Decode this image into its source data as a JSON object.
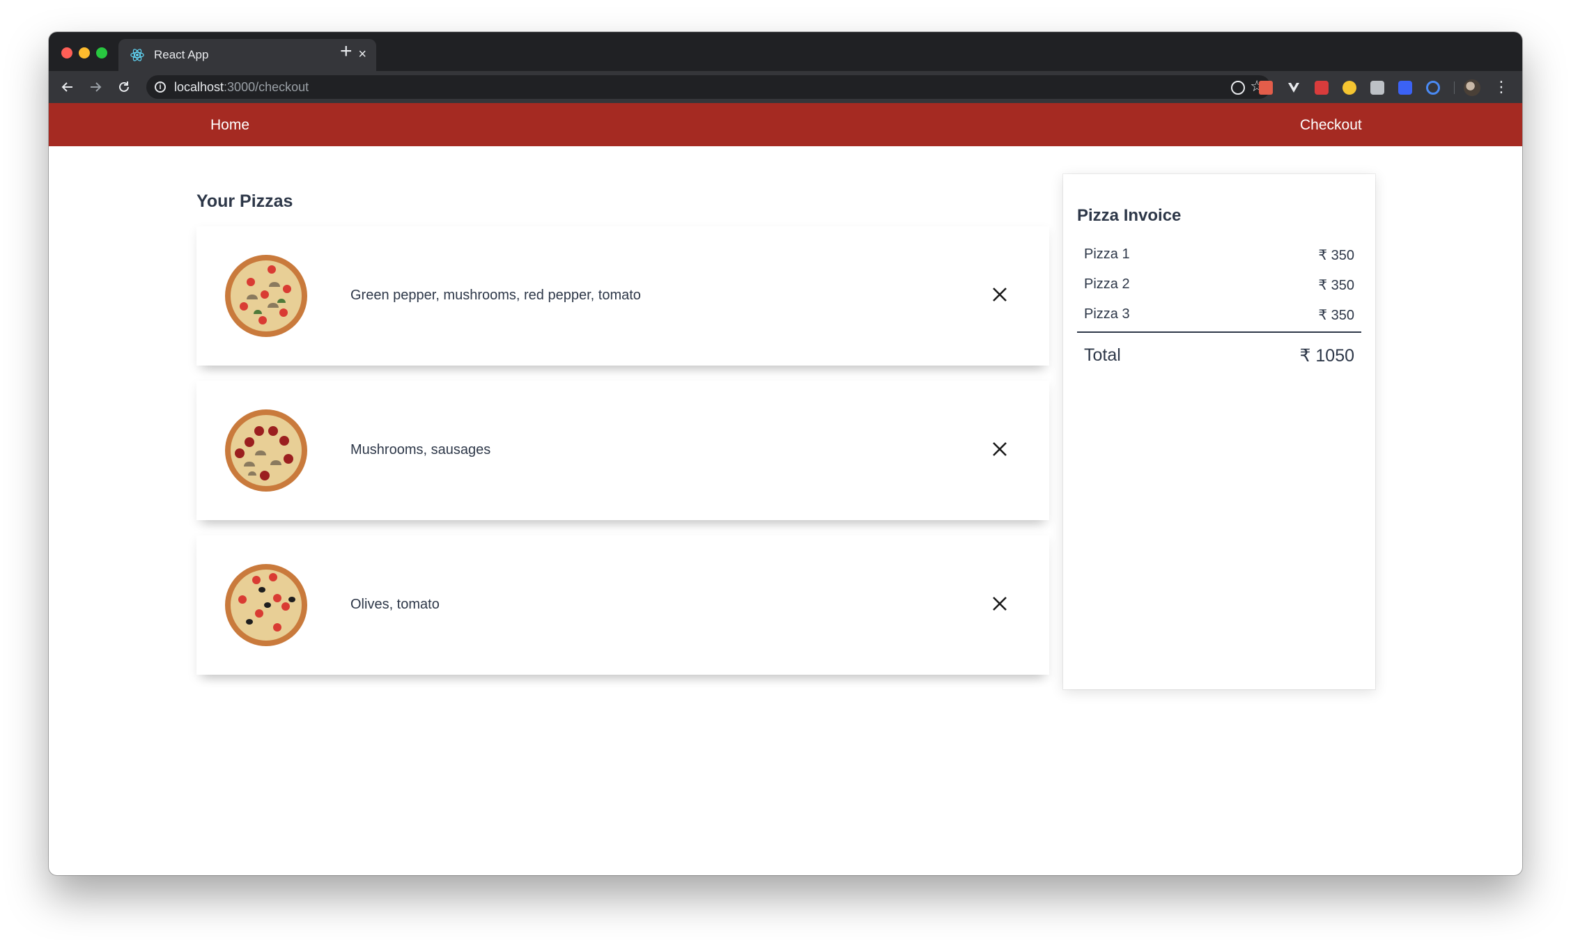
{
  "browser": {
    "tab": {
      "title": "React App",
      "close": "×"
    },
    "new_tab": "+",
    "url": {
      "host": "localhost",
      "path": ":3000/checkout"
    }
  },
  "nav": {
    "home": "Home",
    "checkout": "Checkout"
  },
  "section_title": "Your Pizzas",
  "pizzas": [
    {
      "toppings": "Green pepper, mushrooms, red pepper, tomato"
    },
    {
      "toppings": "Mushrooms, sausages"
    },
    {
      "toppings": "Olives, tomato"
    }
  ],
  "invoice": {
    "title": "Pizza Invoice",
    "items": [
      {
        "name": "Pizza 1",
        "price": "₹ 350"
      },
      {
        "name": "Pizza 2",
        "price": "₹ 350"
      },
      {
        "name": "Pizza 3",
        "price": "₹ 350"
      }
    ],
    "total_label": "Total",
    "total_value": "₹ 1050"
  },
  "colors": {
    "nav_bar": "#a52a22",
    "text": "#2d3748",
    "chrome_dark": "#202124",
    "chrome_toolbar": "#35363a"
  }
}
